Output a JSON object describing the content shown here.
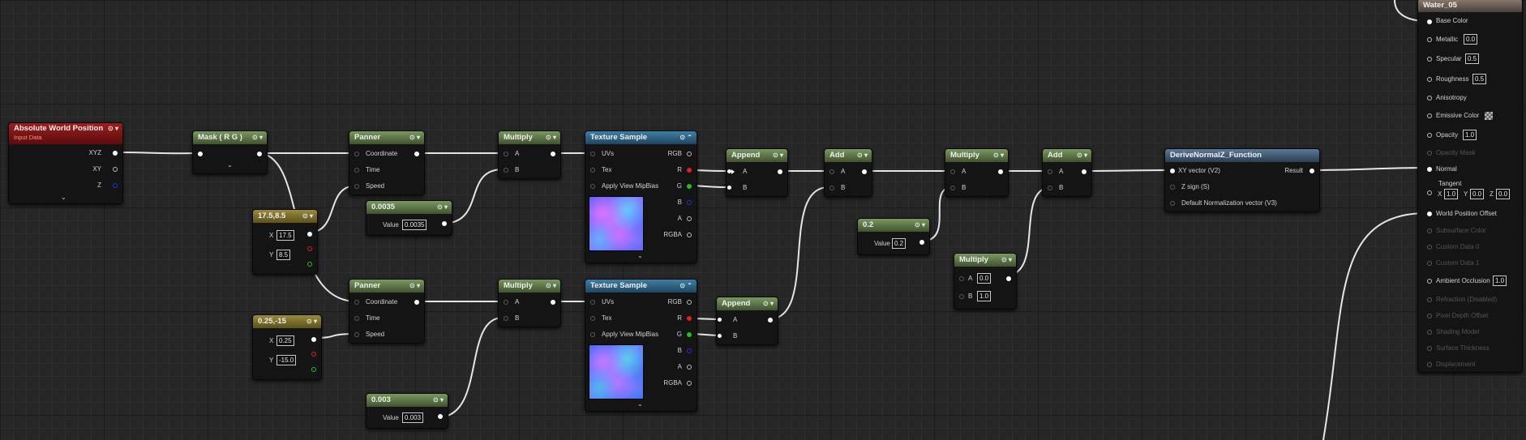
{
  "nodes": {
    "awp": {
      "title": "Absolute World Position",
      "subtitle": "Input Data",
      "xyz": "XYZ",
      "xy": "XY",
      "z": "Z"
    },
    "mask": {
      "title": "Mask ( R G )"
    },
    "c1": {
      "title": "17.5,8.5",
      "x_label": "X",
      "x_value": "17.5",
      "y_label": "Y",
      "y_value": "8.5"
    },
    "c2": {
      "title": "0.25,-15",
      "x_label": "X",
      "x_value": "0.25",
      "y_label": "Y",
      "y_value": "-15.0"
    },
    "panner1": {
      "title": "Panner",
      "coordinate": "Coordinate",
      "time": "Time",
      "speed": "Speed"
    },
    "panner2": {
      "title": "Panner",
      "coordinate": "Coordinate",
      "time": "Time",
      "speed": "Speed"
    },
    "s1": {
      "title": "0.0035",
      "value_label": "Value",
      "value": "0.0035"
    },
    "s2": {
      "title": "0.003",
      "value_label": "Value",
      "value": "0.003"
    },
    "mul1": {
      "title": "Multiply",
      "a": "A",
      "b": "B"
    },
    "mul2": {
      "title": "Multiply",
      "a": "A",
      "b": "B"
    },
    "tex1": {
      "title": "Texture Sample",
      "uvs": "UVs",
      "tex": "Tex",
      "mip": "Apply View MipBias",
      "rgb": "RGB",
      "r": "R",
      "g": "G",
      "b": "B",
      "a": "A",
      "rgba": "RGBA"
    },
    "tex2": {
      "title": "Texture Sample",
      "uvs": "UVs",
      "tex": "Tex",
      "mip": "Apply View MipBias",
      "rgb": "RGB",
      "r": "R",
      "g": "G",
      "b": "B",
      "a": "A",
      "rgba": "RGBA"
    },
    "app1": {
      "title": "Append",
      "a": "A",
      "b": "B"
    },
    "app2": {
      "title": "Append",
      "a": "A",
      "b": "B"
    },
    "add1": {
      "title": "Add",
      "a": "A",
      "b": "B"
    },
    "s3": {
      "title": "0.2",
      "value_label": "Value",
      "value": "0.2"
    },
    "mul3": {
      "title": "Multiply",
      "a": "A",
      "b": "B"
    },
    "mul4": {
      "title": "Multiply",
      "a": "A",
      "a_value": "0.0",
      "b": "B",
      "b_value": "1.0"
    },
    "add2": {
      "title": "Add",
      "a": "A",
      "b": "B"
    },
    "func": {
      "title": "DeriveNormalZ_Function",
      "xy_vector": "XY vector (V2)",
      "z_sign": "Z sign (S)",
      "default_norm": "Default Normalization vector (V3)",
      "result": "Result"
    },
    "mat": {
      "title": "Water_05",
      "base_color": "Base Color",
      "metallic": "Metallic",
      "metallic_value": "0.0",
      "specular": "Specular",
      "specular_value": "0.5",
      "roughness": "Roughness",
      "roughness_value": "0.5",
      "anisotropy": "Anisotropy",
      "emissive": "Emissive Color",
      "opacity": "Opacity",
      "opacity_value": "1.0",
      "opacity_mask": "Opacity Mask",
      "normal": "Normal",
      "tangent": "Tangent",
      "tangent_x_label": "X",
      "tangent_x": "1.0",
      "tangent_y_label": "Y",
      "tangent_y": "0.0",
      "tangent_z_label": "Z",
      "tangent_z": "0.0",
      "wpo": "World Position Offset",
      "subsurface": "Subsurface Color",
      "custom0": "Custom Data 0",
      "custom1": "Custom Data 1",
      "ao": "Ambient Occlusion",
      "ao_value": "1.0",
      "refraction": "Refraction (Disabled)",
      "pdo": "Pixel Depth Offset",
      "shading": "Shading Model",
      "thickness": "Surface Thickness",
      "displacement": "Displacement"
    }
  },
  "icons": {
    "collapse": "chevron-down-icon",
    "preview": "eye-icon",
    "node_menu": "node-options-icon"
  },
  "colors": {
    "red_pin": "#e02020",
    "green_pin": "#20c020",
    "blue_pin": "#2030e0",
    "constant_header": "#9a8b3c",
    "math_header": "#7a9960",
    "texture_header": "#3e7fa6",
    "input_header": "#9d1e1e",
    "function_header": "#5a7a98",
    "material_header": "#8a7a6e"
  }
}
